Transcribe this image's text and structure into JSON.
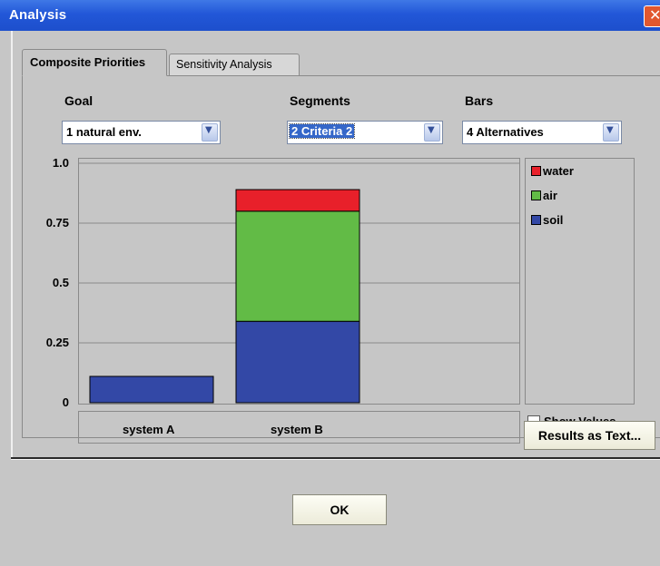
{
  "window": {
    "title": "Analysis",
    "close_icon": "close-icon"
  },
  "tabs": [
    {
      "label": "Composite Priorities",
      "active": true
    },
    {
      "label": "Sensitivity Analysis",
      "active": false
    }
  ],
  "controls": {
    "goal": {
      "label": "Goal",
      "value": "1 natural env."
    },
    "segments": {
      "label": "Segments",
      "value": "2 Criteria 2"
    },
    "bars": {
      "label": "Bars",
      "value": "4 Alternatives"
    }
  },
  "chart_data": {
    "type": "bar",
    "stacked": true,
    "categories": [
      "system A",
      "system B"
    ],
    "series": [
      {
        "name": "soil",
        "color": "#3348a6",
        "values": [
          0.11,
          0.34
        ]
      },
      {
        "name": "air",
        "color": "#62bb46",
        "values": [
          0.0,
          0.46
        ]
      },
      {
        "name": "water",
        "color": "#e8202a",
        "values": [
          0.0,
          0.09
        ]
      }
    ],
    "ylim": [
      0,
      1.0
    ],
    "yticks": [
      {
        "value": 0,
        "label": "0"
      },
      {
        "value": 0.25,
        "label": "0.25"
      },
      {
        "value": 0.5,
        "label": "0.5"
      },
      {
        "value": 0.75,
        "label": "0.75"
      },
      {
        "value": 1.0,
        "label": "1.0"
      }
    ],
    "legend_order": [
      "water",
      "air",
      "soil"
    ],
    "grid": true,
    "legend_placement": "right"
  },
  "options": {
    "show_values_label": "Show Values",
    "show_values_checked": false
  },
  "buttons": {
    "results_as_text": "Results as Text...",
    "ok": "OK"
  }
}
